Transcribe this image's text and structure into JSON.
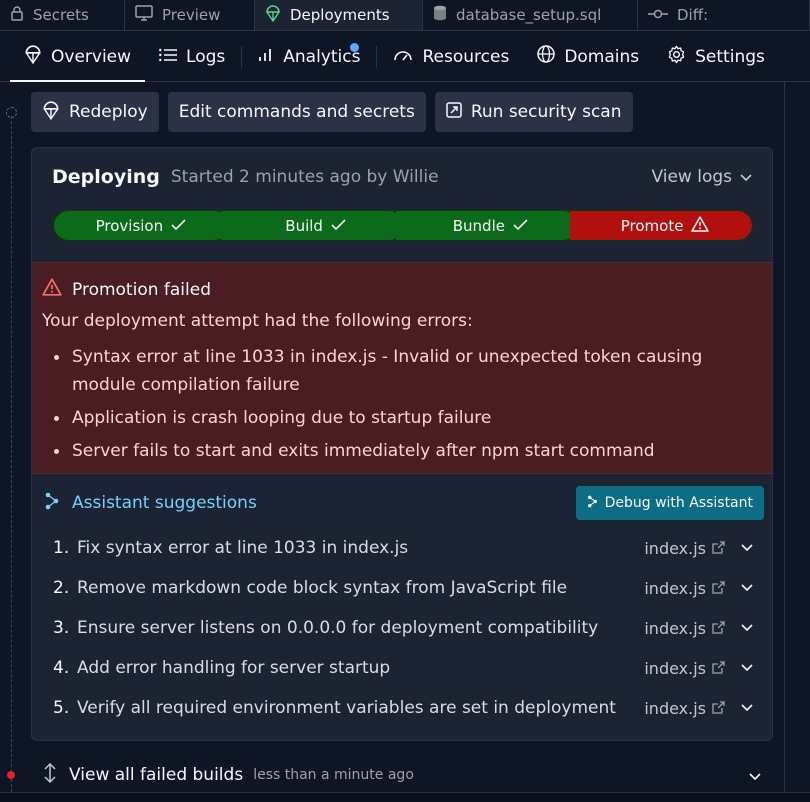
{
  "file_tabs": [
    {
      "label": "Secrets",
      "icon": "lock-icon"
    },
    {
      "label": "Preview",
      "icon": "monitor-icon"
    },
    {
      "label": "Deployments",
      "icon": "deploy-icon"
    },
    {
      "label": "database_setup.sql",
      "icon": "database-icon"
    },
    {
      "label": "Diff:",
      "icon": "commit-icon"
    }
  ],
  "nav": {
    "overview": "Overview",
    "logs": "Logs",
    "analytics": "Analytics",
    "resources": "Resources",
    "domains": "Domains",
    "settings": "Settings"
  },
  "actions": {
    "redeploy": "Redeploy",
    "edit": "Edit commands and secrets",
    "scan": "Run security scan"
  },
  "deployment": {
    "status": "Deploying",
    "subtitle": "Started 2 minutes ago by Willie",
    "view_logs": "View logs",
    "steps": [
      {
        "label": "Provision",
        "state": "done"
      },
      {
        "label": "Build",
        "state": "done"
      },
      {
        "label": "Bundle",
        "state": "done"
      },
      {
        "label": "Promote",
        "state": "failed"
      }
    ]
  },
  "error": {
    "title": "Promotion failed",
    "intro": "Your deployment attempt had the following errors:",
    "items": [
      "Syntax error at line 1033 in index.js - Invalid or unexpected token causing module compilation failure",
      "Application is crash looping due to startup failure",
      "Server fails to start and exits immediately after npm start command"
    ]
  },
  "assistant": {
    "title": "Assistant suggestions",
    "debug_button": "Debug with Assistant",
    "suggestions": [
      {
        "num": "1.",
        "text": "Fix syntax error at line 1033 in index.js",
        "file": "index.js"
      },
      {
        "num": "2.",
        "text": "Remove markdown code block syntax from JavaScript file",
        "file": "index.js"
      },
      {
        "num": "3.",
        "text": "Ensure server listens on 0.0.0.0 for deployment compatibility",
        "file": "index.js"
      },
      {
        "num": "4.",
        "text": "Add error handling for server startup",
        "file": "index.js"
      },
      {
        "num": "5.",
        "text": "Verify all required environment variables are set in deployment",
        "file": "index.js"
      }
    ]
  },
  "footer": {
    "title": "View all failed builds",
    "subtitle": "less than a minute ago"
  },
  "colors": {
    "background": "#0e1525",
    "card": "#1c2333",
    "success": "#0b6b1a",
    "failure": "#b20f0f",
    "error_panel": "#4a1d22",
    "assistant_accent": "#73d2ff",
    "debug_button": "#0c6d85",
    "notification_dot": "#57abff"
  }
}
